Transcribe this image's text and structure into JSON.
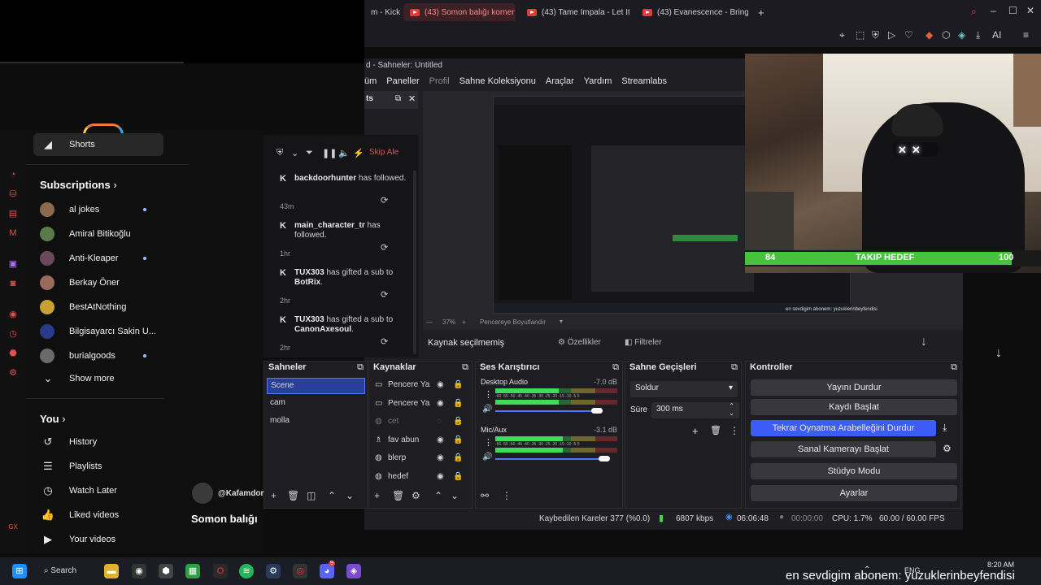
{
  "browser": {
    "tabs": [
      {
        "label": "m - Kick",
        "active": false
      },
      {
        "label": "(43) Somon balığı korner t",
        "active": true
      },
      {
        "label": "(43) Tame Impala - Let It",
        "active": false
      },
      {
        "label": "(43) Evanescence - Bring",
        "active": false
      }
    ],
    "new_tab": "+",
    "toolbar_ai": "AI"
  },
  "youtube": {
    "shorts": "Shorts",
    "subscriptions_header": "Subscriptions",
    "subscriptions": [
      {
        "name": "al jokes",
        "dot": true,
        "color": "#8a6a4a"
      },
      {
        "name": "Amiral Bitikoğlu",
        "dot": false,
        "color": "#5a7a4a"
      },
      {
        "name": "Anti-Kleaper",
        "dot": true,
        "color": "#6a4a5a"
      },
      {
        "name": "Berkay Öner",
        "dot": false,
        "color": "#9a6a5a"
      },
      {
        "name": "BestAtNothing",
        "dot": false,
        "color": "#c8a030"
      },
      {
        "name": "Bilgisayarcı Sakin U...",
        "dot": false,
        "color": "#2a3a8a"
      },
      {
        "name": "burialgoods",
        "dot": true,
        "color": "#6a6a6a"
      }
    ],
    "show_more": "Show more",
    "you_header": "You",
    "you_items": [
      {
        "label": "History",
        "icon": "history-icon"
      },
      {
        "label": "Playlists",
        "icon": "playlists-icon"
      },
      {
        "label": "Watch Later",
        "icon": "watch-later-icon"
      },
      {
        "label": "Liked videos",
        "icon": "liked-videos-icon"
      },
      {
        "label": "Your videos",
        "icon": "your-videos-icon"
      }
    ],
    "comment_user": "@Kafamdor",
    "video_title": "Somon balığı"
  },
  "obs": {
    "title": "d - Sahneler: Untitled",
    "menu": [
      "üm",
      "Paneller",
      "Profil",
      "Sahne Koleksiyonu",
      "Araçlar",
      "Yardım",
      "Streamlabs"
    ],
    "chat_dock_title": "ts",
    "chat_skip": "Skip Ale",
    "chat_events": [
      {
        "user": "backdoorhunter",
        "text": "has followed.",
        "time": "43m"
      },
      {
        "user": "main_character_tr",
        "text": "has followed.",
        "time": "1hr"
      },
      {
        "user": "TUX303",
        "text": "has gifted a sub to",
        "target": "BotRix",
        "time": "2hr"
      },
      {
        "user": "TUX303",
        "text": "has gifted a sub to",
        "target": "CanonAxesoul",
        "time": "2hr"
      }
    ],
    "preview_zoom": "37%",
    "preview_fit": "Pencereye Boyutlandır",
    "no_source": "Kaynak seçilmemiş",
    "properties_btn": "Özellikler",
    "filters_btn": "Filtreler",
    "scenes": {
      "title": "Sahneler",
      "items": [
        "Scene",
        "cam",
        "molla"
      ],
      "selected": "Scene"
    },
    "sources": {
      "title": "Kaynaklar",
      "items": [
        {
          "name": "Pencere Ya",
          "icon": "window-icon",
          "hidden": false
        },
        {
          "name": "Pencere Ya",
          "icon": "window-icon",
          "hidden": false
        },
        {
          "name": "cet",
          "icon": "globe-icon",
          "hidden": true
        },
        {
          "name": "fav abun",
          "icon": "kick-icon",
          "hidden": false
        },
        {
          "name": "blerp",
          "icon": "globe-icon",
          "hidden": false
        },
        {
          "name": "hedef",
          "icon": "globe-icon",
          "hidden": false
        }
      ]
    },
    "mixer": {
      "title": "Ses Karıştırıcı",
      "channels": [
        {
          "name": "Desktop Audio",
          "db": "-7.0 dB",
          "level": 0.52,
          "volume": 0.83
        },
        {
          "name": "Mic/Aux",
          "db": "-3.1 dB",
          "level": 0.55,
          "volume": 0.89
        }
      ],
      "scale": "-60 -55 -50 -45 -40 -35 -30 -25 -20 -15 -10 -5 0"
    },
    "transitions": {
      "title": "Sahne Geçişleri",
      "type": "Soldur",
      "duration_label": "Süre",
      "duration": "300 ms"
    },
    "controls": {
      "title": "Kontroller",
      "buttons": [
        "Yayını Durdur",
        "Kaydı Başlat",
        "Tekrar Oynatma Arabelleğini Durdur",
        "Sanal Kamerayı Başlat",
        "Stüdyo Modu",
        "Ayarlar"
      ],
      "active_index": 2
    },
    "status": {
      "dropped": "Kaybedilen Kareler 377 (%0.0)",
      "bitrate": "6807 kbps",
      "live_time": "06:06:48",
      "rec_time": "00:00:00",
      "cpu": "CPU: 1.7%",
      "fps": "60.00 / 60.00 FPS"
    }
  },
  "overlay": {
    "goal_current": "84",
    "goal_label": "TAKIP HEDEF",
    "goal_target": "100",
    "goal_fraction": 0.84,
    "ticker": "en sevdigim abonem: yuzuklerinbeyfendisi"
  },
  "taskbar": {
    "search": "Search",
    "lang": "ENG",
    "time": "8:20 AM",
    "discord_badge": "9"
  },
  "colors": {
    "obs_bg": "#1e1e22",
    "obs_accent": "#3d5bf5",
    "goal_green": "#46c23c",
    "yt_red": "#e53935"
  }
}
